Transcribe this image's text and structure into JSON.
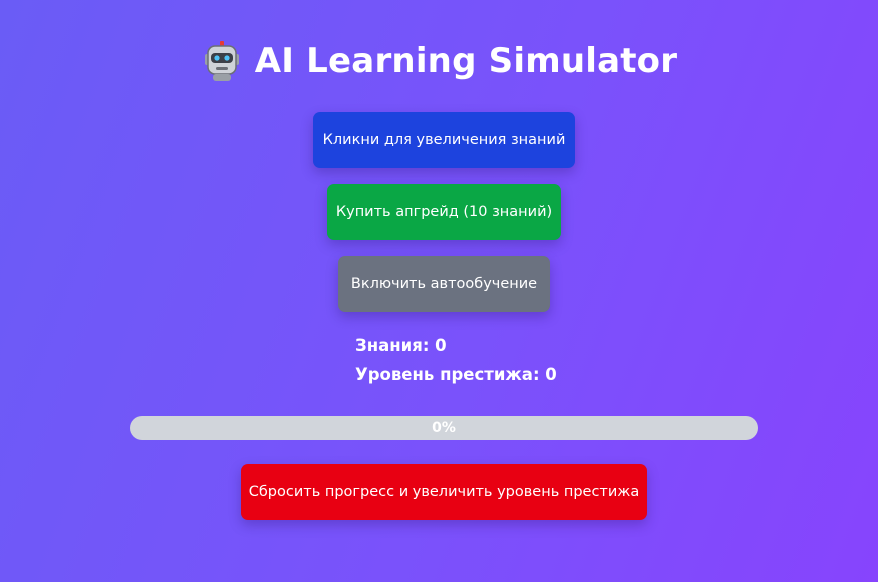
{
  "header": {
    "title": "AI Learning Simulator",
    "icon": "robot-icon"
  },
  "buttons": {
    "learn_label": "Кликни для увеличения знаний",
    "upgrade_label": "Купить апгрейд (10 знаний)",
    "auto_label": "Включить автообучение",
    "reset_label": "Сбросить прогресс и увеличить уровень престижа"
  },
  "stats": {
    "knowledge_text": "Знания: 0",
    "prestige_text": "Уровень престижа: 0"
  },
  "progress": {
    "value": 0,
    "label": "0%"
  },
  "colors": {
    "learn_button": "#1d43de",
    "upgrade_button": "#0aa745",
    "auto_button": "#6b7280",
    "reset_button": "#e80012",
    "progress_track": "#d1d5db"
  }
}
